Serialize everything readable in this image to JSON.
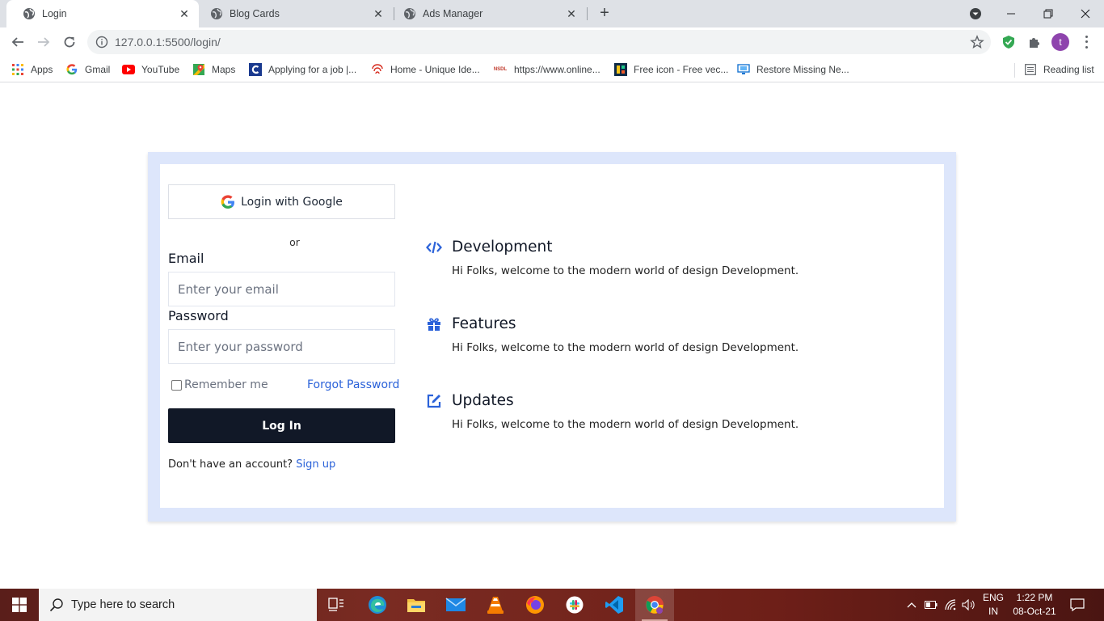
{
  "browser": {
    "tabs": [
      {
        "title": "Login",
        "active": true
      },
      {
        "title": "Blog Cards",
        "active": false
      },
      {
        "title": "Ads Manager",
        "active": false
      }
    ],
    "url": "127.0.0.1:5500/login/",
    "profile_initial": "t",
    "bookmarks": [
      {
        "label": "Apps",
        "icon": "apps-grid-icon"
      },
      {
        "label": "Gmail",
        "icon": "google-icon"
      },
      {
        "label": "YouTube",
        "icon": "youtube-icon"
      },
      {
        "label": "Maps",
        "icon": "maps-icon"
      },
      {
        "label": "Applying for a job |...",
        "icon": "c-logo-icon"
      },
      {
        "label": "Home - Unique Ide...",
        "icon": "fingerprint-icon"
      },
      {
        "label": "https://www.online...",
        "icon": "nsdl-icon"
      },
      {
        "label": "Free icon - Free vec...",
        "icon": "freepik-icon"
      },
      {
        "label": "Restore Missing Ne...",
        "icon": "monitor-icon"
      }
    ],
    "reading_list": "Reading list"
  },
  "login": {
    "google_button": "Login with Google",
    "or_text": "or",
    "email_label": "Email",
    "email_placeholder": "Enter your email",
    "password_label": "Password",
    "password_placeholder": "Enter your password",
    "remember_label": "Remember me",
    "forgot_link": "Forgot Password",
    "login_button": "Log In",
    "signup_prompt": "Don't have an account?",
    "signup_link": "Sign up"
  },
  "features": [
    {
      "title": "Development",
      "description": "Hi Folks, welcome to the modern world of design Development.",
      "icon": "code-icon"
    },
    {
      "title": "Features",
      "description": "Hi Folks, welcome to the modern world of design Development.",
      "icon": "gift-icon"
    },
    {
      "title": "Updates",
      "description": "Hi Folks, welcome to the modern world of design Development.",
      "icon": "edit-icon"
    }
  ],
  "taskbar": {
    "search_placeholder": "Type here to search",
    "language_line1": "ENG",
    "language_line2": "IN",
    "time": "1:22 PM",
    "date": "08-Oct-21"
  },
  "colors": {
    "accent_blue": "#2b62d9",
    "login_button_bg": "#111827",
    "frame_bg": "#dde6fb"
  }
}
